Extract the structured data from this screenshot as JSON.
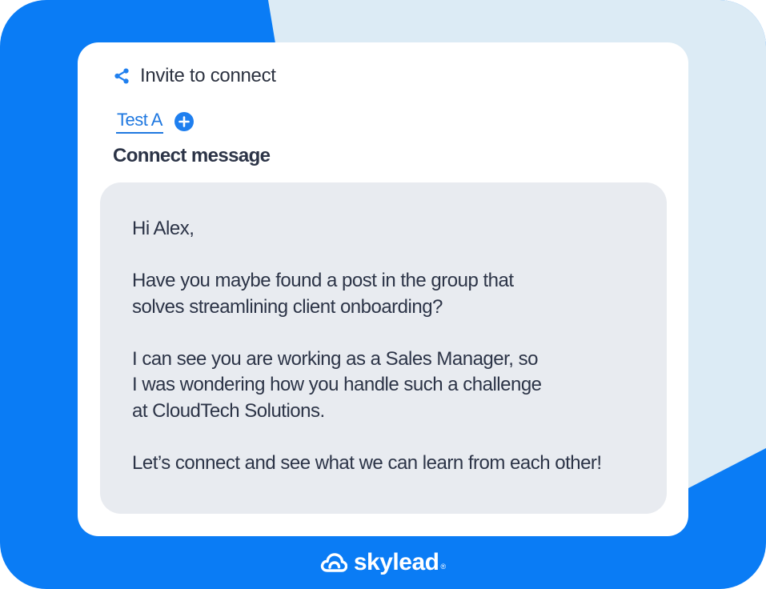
{
  "colors": {
    "brand_blue": "#0A7CF5",
    "light_blue": "#DCEBF5",
    "card_bg": "#FFFFFF",
    "message_bg": "#E8EBF0",
    "text_dark": "#2C3447",
    "accent": "#1F78E0"
  },
  "header": {
    "icon": "share-icon",
    "title": "Invite to connect"
  },
  "tabs": {
    "items": [
      {
        "label": "Test A",
        "active": true
      }
    ],
    "add_icon": "plus-circle-icon"
  },
  "message": {
    "section_label": "Connect message",
    "lines": [
      "Hi Alex,",
      "",
      "Have you maybe found a post in the group that",
      "solves streamlining client onboarding?",
      "",
      "I can see you are working as a Sales Manager, so",
      "I was wondering how you handle such a challenge",
      "at CloudTech Solutions.",
      "",
      "Let’s connect and see what we can learn from each other!"
    ]
  },
  "brand": {
    "logo_icon": "skylead-cloud-icon",
    "name": "skylead",
    "registered_mark": "®"
  }
}
